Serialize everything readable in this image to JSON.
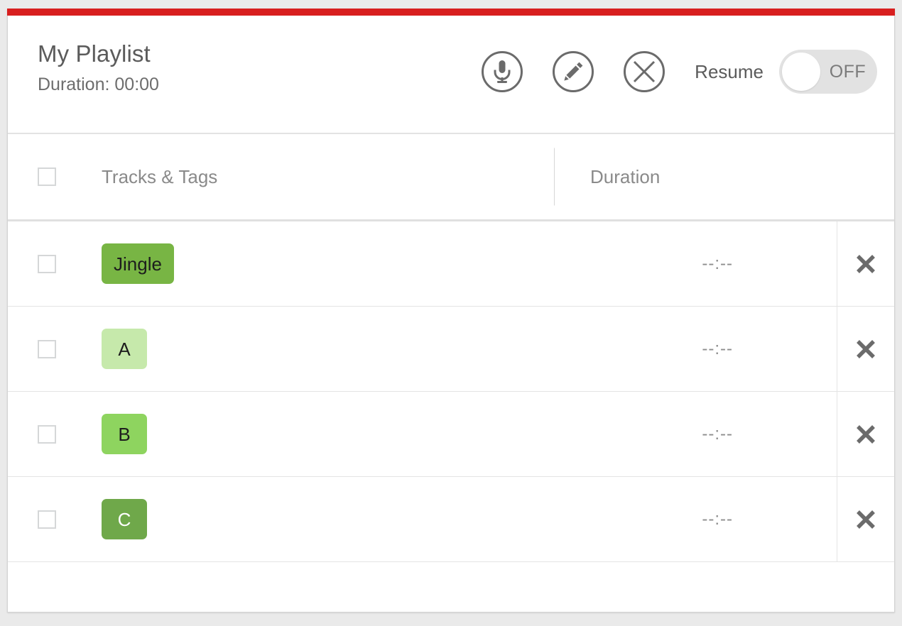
{
  "theme": {
    "accent_bar_color": "#d81f1f",
    "page_background": "#eaeaea",
    "panel_background": "#ffffff",
    "text_color": "#5b5b5b",
    "muted_text_color": "#8a8a8a"
  },
  "header": {
    "title": "My Playlist",
    "duration_label": "Duration: 00:00",
    "actions": [
      {
        "name": "microphone-icon",
        "label": "Record"
      },
      {
        "name": "pencil-icon",
        "label": "Edit"
      },
      {
        "name": "close-circle-icon",
        "label": "Clear"
      }
    ],
    "resume": {
      "label": "Resume",
      "state": "OFF",
      "enabled": false
    }
  },
  "table": {
    "columns": {
      "select_all": "",
      "tracks": "Tracks & Tags",
      "duration": "Duration",
      "delete": ""
    },
    "rows": [
      {
        "tag": "Jingle",
        "tag_color": "#78b544",
        "tag_text_color": "#1d1d1d",
        "duration": "--:--",
        "checked": false,
        "delete_label": "✖"
      },
      {
        "tag": "A",
        "tag_color": "#c6e9ab",
        "tag_text_color": "#1d1d1d",
        "duration": "--:--",
        "checked": false,
        "delete_label": "✖"
      },
      {
        "tag": "B",
        "tag_color": "#8ed45f",
        "tag_text_color": "#1d1d1d",
        "duration": "--:--",
        "checked": false,
        "delete_label": "✖"
      },
      {
        "tag": "C",
        "tag_color": "#6fa84a",
        "tag_text_color": "#ffffff",
        "duration": "--:--",
        "checked": false,
        "delete_label": "✖"
      }
    ]
  }
}
